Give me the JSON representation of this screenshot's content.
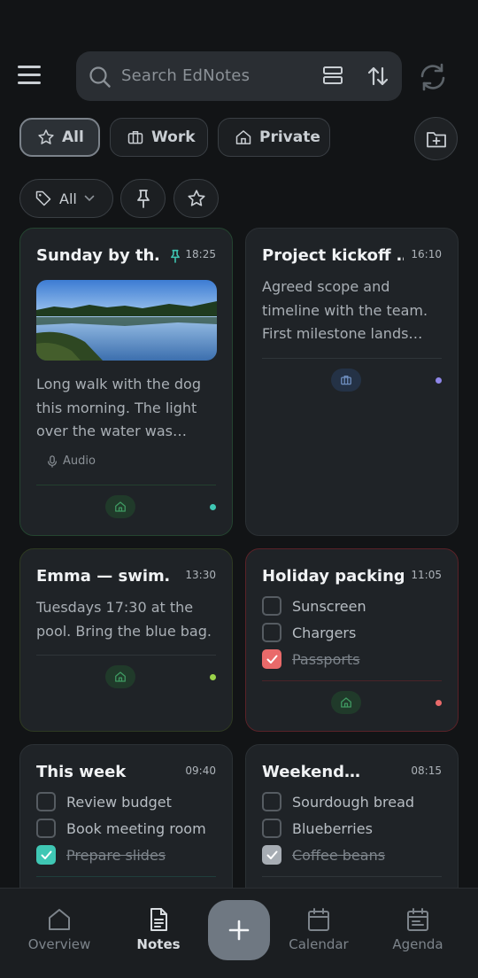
{
  "search": {
    "placeholder": "Search EdNotes"
  },
  "filters": {
    "all_label": "All",
    "work_label": "Work",
    "private_label": "Private",
    "tag_filter_label": "All"
  },
  "colors": {
    "background": "#121416",
    "card": "#1f2327",
    "teal_accent": "#3fc7b4",
    "red_accent": "#e96a6a",
    "lime_dot": "#9bd34a",
    "purple_dot": "#8e86e8"
  },
  "notes": [
    {
      "title": "Sunday by th…",
      "time": "18:25",
      "pinned": true,
      "body": [
        "Long walk with the dog",
        "this morning. The light",
        "over the water was…"
      ],
      "attachment": "Audio",
      "category_icon": "home-icon"
    },
    {
      "title": "Project kickoff …",
      "time": "16:10",
      "body": [
        "Agreed scope and",
        "timeline with the team.",
        "First milestone lands…"
      ],
      "category_icon": "briefcase-icon"
    },
    {
      "title": "Emma — swim…",
      "time": "13:30",
      "body": [
        "Tuesdays 17:30 at the",
        "pool. Bring the blue bag."
      ],
      "category_icon": "home-icon"
    },
    {
      "title": "Holiday packing",
      "time": "11:05",
      "items": [
        {
          "text": "Sunscreen",
          "done": false
        },
        {
          "text": "Chargers",
          "done": false
        },
        {
          "text": "Passports",
          "done": true
        }
      ],
      "category_icon": "home-icon"
    },
    {
      "title": "This week",
      "time": "09:40",
      "items": [
        {
          "text": "Review budget",
          "done": false
        },
        {
          "text": "Book meeting room",
          "done": false
        },
        {
          "text": "Prepare slides",
          "done": true
        }
      ]
    },
    {
      "title": "Weekend…",
      "time": "08:15",
      "items": [
        {
          "text": "Sourdough bread",
          "done": false
        },
        {
          "text": "Blueberries",
          "done": false
        },
        {
          "text": "Coffee beans",
          "done": true
        }
      ]
    }
  ],
  "nav": {
    "overview": "Overview",
    "notes": "Notes",
    "calendar": "Calendar",
    "agenda": "Agenda",
    "active": "notes"
  }
}
